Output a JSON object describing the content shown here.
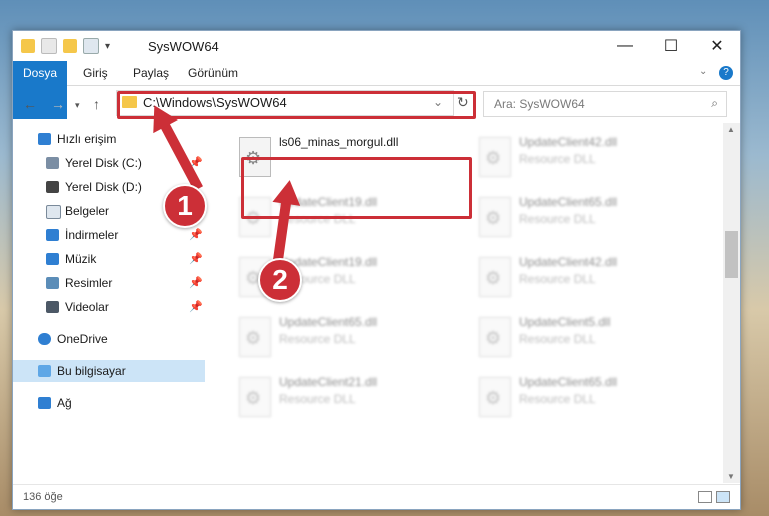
{
  "window": {
    "title": "SysWOW64",
    "controls": [
      "—",
      "☐",
      "✕"
    ],
    "help_icon": "?"
  },
  "ribbon": {
    "tabs": [
      "Dosya",
      "Giriş",
      "Paylaş",
      "Görünüm"
    ]
  },
  "address": {
    "path": "C:\\Windows\\SysWOW64",
    "search_placeholder": "Ara: SysWOW64"
  },
  "sidebar": {
    "items": [
      {
        "label": "Hızlı erişim",
        "icon": "star-icon"
      },
      {
        "label": "Yerel Disk (C:)",
        "icon": "drive-icon"
      },
      {
        "label": "Yerel Disk (D:)",
        "icon": "drive-icon"
      },
      {
        "label": "Belgeler",
        "icon": "document-icon"
      },
      {
        "label": "İndirmeler",
        "icon": "download-icon"
      },
      {
        "label": "Müzik",
        "icon": "music-icon"
      },
      {
        "label": "Resimler",
        "icon": "image-icon"
      },
      {
        "label": "Videolar",
        "icon": "video-icon"
      },
      {
        "label": "OneDrive",
        "icon": "cloud-icon"
      },
      {
        "label": "Bu bilgisayar",
        "icon": "computer-icon"
      },
      {
        "label": "Ağ",
        "icon": "network-icon"
      }
    ]
  },
  "files": {
    "main": {
      "name": "ls06_minas_morgul.dll"
    },
    "blurred": [
      {
        "name": "UpdateClient42.dll",
        "type": "Resource DLL"
      },
      {
        "name": "UpdateClient19.dll",
        "type": "Resource DLL"
      },
      {
        "name": "UpdateClient65.dll",
        "type": "Resource DLL"
      },
      {
        "name": "UpdateClient19.dll",
        "type": "Resource DLL"
      },
      {
        "name": "UpdateClient42.dll",
        "type": "Resource DLL"
      },
      {
        "name": "UpdateClient65.dll",
        "type": "Resource DLL"
      },
      {
        "name": "UpdateClient5.dll",
        "type": "Resource DLL"
      },
      {
        "name": "UpdateClient21.dll",
        "type": "Resource DLL"
      },
      {
        "name": "UpdateClient65.dll",
        "type": "Resource DLL"
      }
    ]
  },
  "status": {
    "count": "136 öğe"
  },
  "annotations": {
    "one": "1",
    "two": "2"
  },
  "colors": {
    "accent": "#1979ca",
    "annotation_red": "#cc2f37",
    "selection": "#cce4f7"
  }
}
